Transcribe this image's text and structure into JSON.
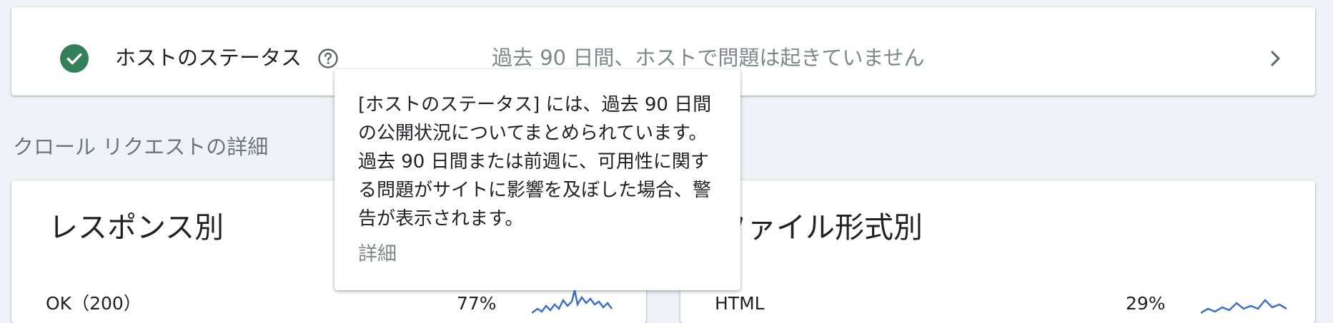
{
  "host_status": {
    "title": "ホストのステータス",
    "summary": "過去 90 日間、ホストで問題は起きていません",
    "status_color": "#34805a",
    "status_icon": "check-circle-icon",
    "help_icon": "help-circle-icon",
    "chevron_icon": "chevron-right-icon"
  },
  "crawl_details": {
    "section_title": "クロール リクエストの詳細"
  },
  "by_response": {
    "title": "レスポンス別",
    "rows": [
      {
        "label": "OK（200）",
        "percent": "77%"
      }
    ]
  },
  "by_filetype": {
    "title": "ファイル形式別",
    "rows": [
      {
        "label": "HTML",
        "percent": "29%"
      }
    ]
  },
  "tooltip": {
    "body": "[ホストのステータス] には、過去 90 日間の公開状況についてまとめられています。過去 90 日間または前週に、可用性に関する問題がサイトに影響を及ぼした場合、警告が表示されます。",
    "link_label": "詳細"
  },
  "colors": {
    "background": "#eff2f7",
    "sparkline": "#3d6fc4"
  }
}
